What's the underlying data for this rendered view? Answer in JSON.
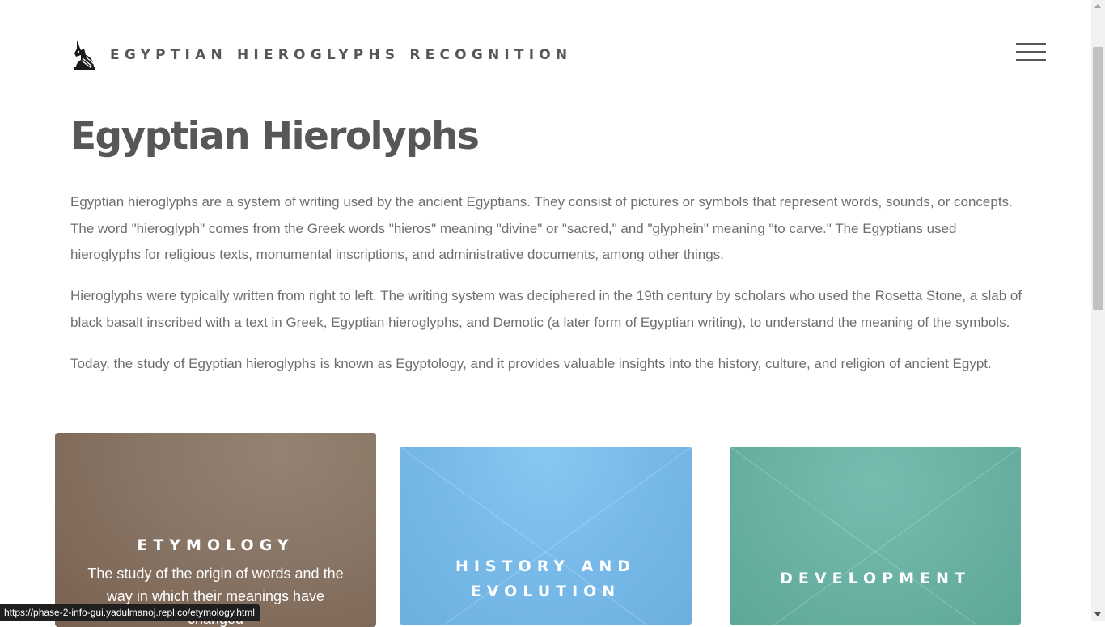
{
  "header": {
    "logo_icon": "anubis-jackal-icon",
    "site_title": "EGYPTIAN HIEROGLYPHS RECOGNITION",
    "menu_icon": "hamburger-menu-icon"
  },
  "main": {
    "title": "Egyptian Hierolyphs",
    "paragraphs": [
      "Egyptian hieroglyphs are a system of writing used by the ancient Egyptians. They consist of pictures or symbols that represent words, sounds, or concepts. The word \"hieroglyph\" comes from the Greek words \"hieros\" meaning \"divine\" or \"sacred,\" and \"glyphein\" meaning \"to carve.\" The Egyptians used hieroglyphs for religious texts, monumental inscriptions, and administrative documents, among other things.",
      "Hieroglyphs were typically written from right to left. The writing system was deciphered in the 19th century by scholars who used the Rosetta Stone, a slab of black basalt inscribed with a text in Greek, Egyptian hieroglyphs, and Demotic (a later form of Egyptian writing), to understand the meaning of the symbols.",
      "Today, the study of Egyptian hieroglyphs is known as Egyptology, and it provides valuable insights into the history, culture, and religion of ancient Egypt."
    ]
  },
  "tiles": [
    {
      "heading": "ETYMOLOGY",
      "description": "The study of the origin of words and the way in which their meanings have changed",
      "color": "#887565"
    },
    {
      "heading": "HISTORY AND EVOLUTION",
      "color": "#77baea"
    },
    {
      "heading": "DEVELOPMENT",
      "color": "#6ab2a4"
    }
  ],
  "status_bar": {
    "url": "https://phase-2-info-gui.yadulmanoj.repl.co/etymology.html"
  }
}
